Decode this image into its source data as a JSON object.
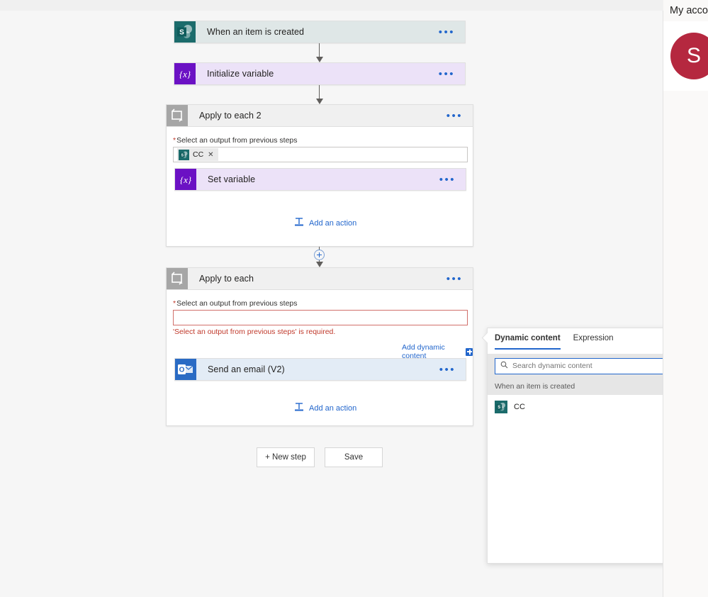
{
  "flow": {
    "trigger": {
      "title": "When an item is created",
      "icon": "sharepoint-icon",
      "menu": "•••"
    },
    "initialize_variable": {
      "title": "Initialize variable",
      "icon": "variable-icon",
      "menu": "•••"
    },
    "apply_to_each_2": {
      "title": "Apply to each 2",
      "icon": "loop-icon",
      "menu": "•••",
      "field_label": "Select an output from previous steps",
      "required_marker": "*",
      "token": {
        "label": "CC",
        "remove": "✕",
        "icon": "sharepoint-icon"
      },
      "child_action": {
        "title": "Set variable",
        "icon": "variable-icon",
        "menu": "•••"
      },
      "add_action_label": "Add an action"
    },
    "apply_to_each": {
      "title": "Apply to each",
      "icon": "loop-icon",
      "menu": "•••",
      "field_label": "Select an output from previous steps",
      "required_marker": "*",
      "field_value": "",
      "error_text": "'Select an output from previous steps' is required.",
      "add_dynamic_content_label": "Add dynamic content",
      "child_action": {
        "title": "Send an email (V2)",
        "icon": "outlook-icon",
        "menu": "•••"
      },
      "add_action_label": "Add an action"
    }
  },
  "footer": {
    "new_step_label": "+ New step",
    "save_label": "Save"
  },
  "dynamic_content_panel": {
    "tabs": [
      {
        "label": "Dynamic content",
        "active": true
      },
      {
        "label": "Expression",
        "active": false
      }
    ],
    "search_placeholder": "Search dynamic content",
    "search_value": "",
    "groups": [
      {
        "header": "When an item is created",
        "items": [
          {
            "label": "CC",
            "icon": "sharepoint-icon"
          }
        ]
      }
    ]
  },
  "account_flyout": {
    "title": "My account",
    "avatar_initial": "S"
  },
  "colors": {
    "canvas": "#f6f6f6",
    "sharepoint_card": "#dfe7e7",
    "sharepoint_tile": "#1b6b6b",
    "variable_card": "#ece2f8",
    "variable_tile": "#6b11c4",
    "outlook_card": "#e3ecf6",
    "outlook_tile": "#2a6bc4",
    "loop_header": "#f0f0f0",
    "loop_tile": "#a6a6a6",
    "accent_link": "#2266cc",
    "error": "#c0392b",
    "avatar": "#b5283f"
  }
}
